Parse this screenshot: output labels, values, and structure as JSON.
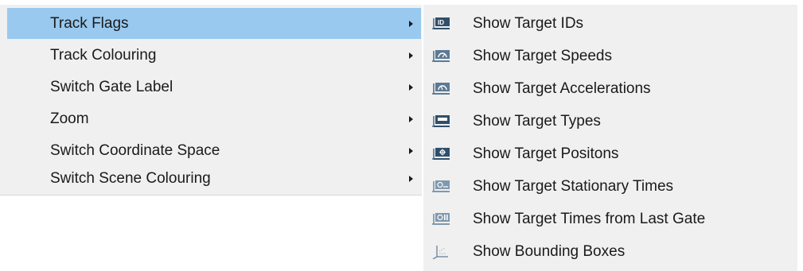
{
  "context_menu": {
    "items": [
      {
        "label": "Track Flags",
        "has_submenu": true,
        "active": true
      },
      {
        "label": "Track Colouring",
        "has_submenu": true
      },
      {
        "label": "Switch Gate Label",
        "has_submenu": true
      },
      {
        "label": "Zoom",
        "has_submenu": true
      },
      {
        "label": "Switch Coordinate Space",
        "has_submenu": true
      },
      {
        "label": "Switch Scene Colouring",
        "has_submenu": true
      }
    ],
    "highlight_color": "#99c9ef",
    "background_color": "#f0f0f0"
  },
  "submenu": {
    "items": [
      {
        "label": "Show Target IDs",
        "icon": "target-id-icon"
      },
      {
        "label": "Show Target Speeds",
        "icon": "target-speed-icon"
      },
      {
        "label": "Show Target Accelerations",
        "icon": "target-acceleration-icon"
      },
      {
        "label": "Show Target Types",
        "icon": "target-type-icon"
      },
      {
        "label": "Show Target Positons",
        "icon": "target-position-icon"
      },
      {
        "label": "Show Target Stationary Times",
        "icon": "target-stationary-time-icon"
      },
      {
        "label": "Show Target Times from Last Gate",
        "icon": "target-time-last-gate-icon"
      },
      {
        "label": "Show Bounding Boxes",
        "icon": "bounding-box-icon"
      }
    ]
  }
}
